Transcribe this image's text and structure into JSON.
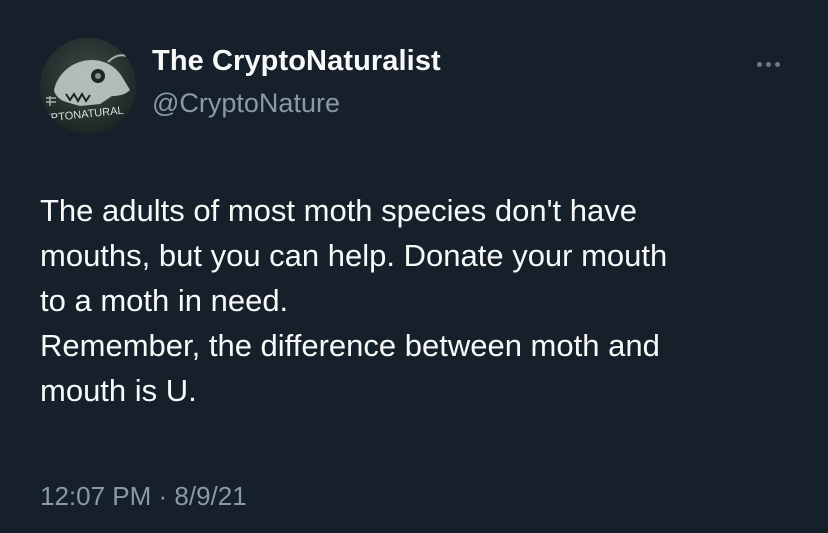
{
  "colors": {
    "background": "#15202b",
    "primary_text": "#f7f9f9",
    "secondary_text": "#8b98a5"
  },
  "author": {
    "display_name": "The CryptoNaturalist",
    "handle": "@CryptoNature",
    "avatar_icon": "fox-skull-avatar-icon",
    "avatar_text": "YPTONATURAL"
  },
  "more_icon": "more-options-icon",
  "tweet": {
    "lines": [
      "The adults of most moth species don't have",
      "mouths, but you can help. Donate your mouth",
      "to a moth in need.",
      "Remember, the difference between moth and",
      "mouth is U."
    ],
    "time": "12:07 PM",
    "separator": " · ",
    "date": "8/9/21"
  }
}
